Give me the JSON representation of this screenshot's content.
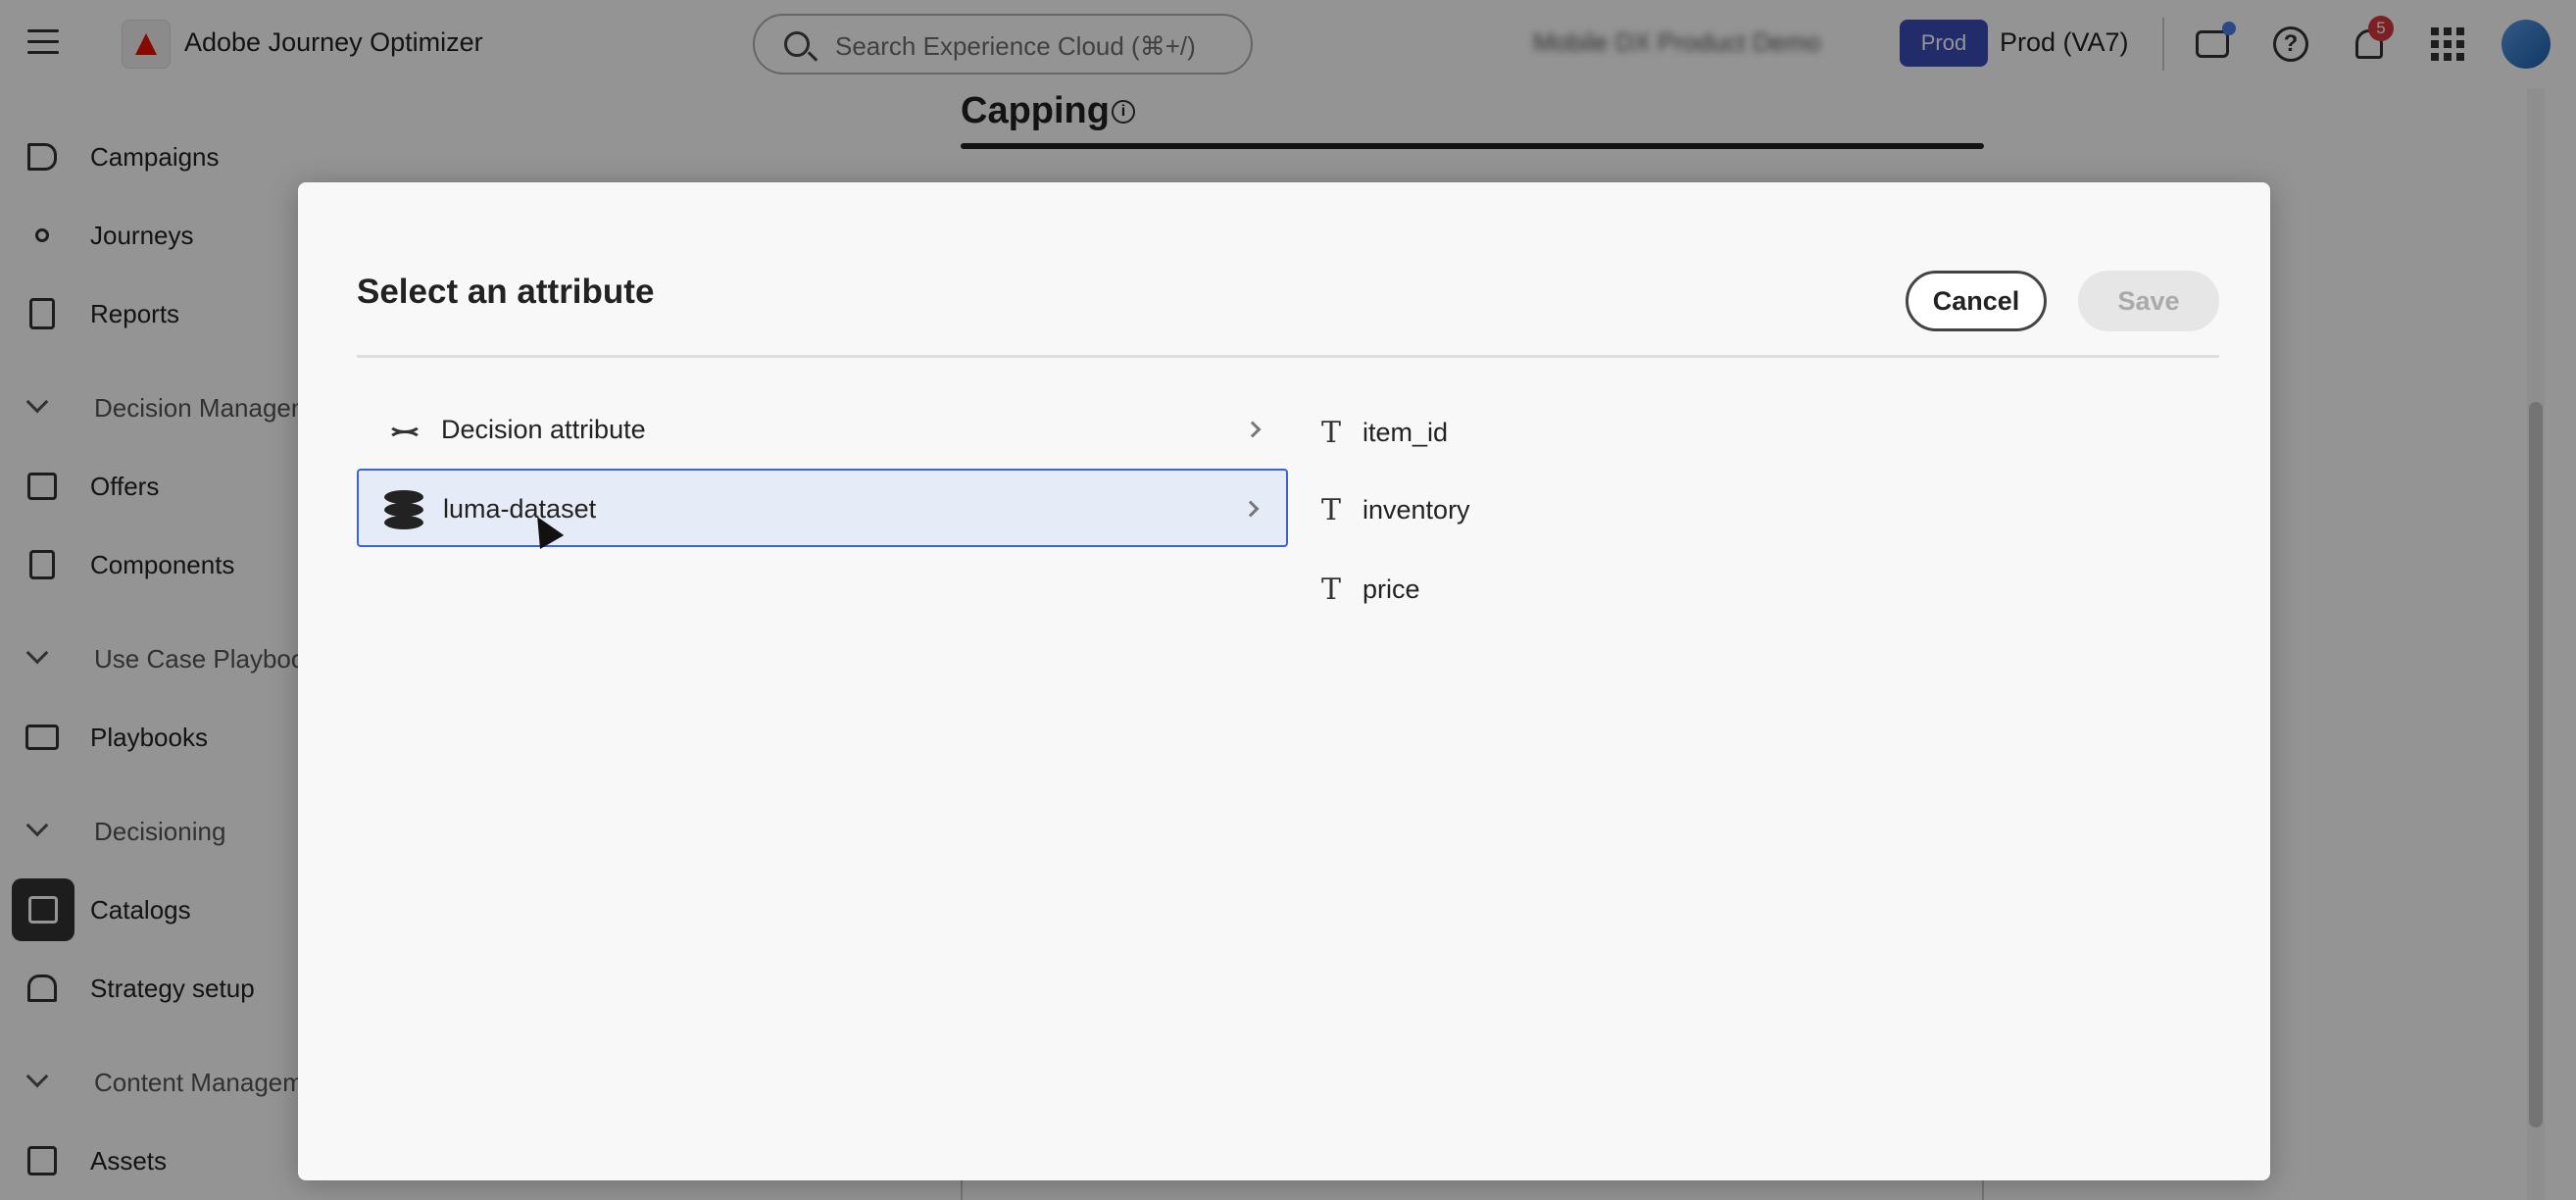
{
  "app": {
    "title": "Adobe Journey Optimizer"
  },
  "search": {
    "placeholder": "Search Experience Cloud (⌘+/)"
  },
  "header": {
    "org_name": "Mobile DX Product Demo",
    "sandbox_badge": "Prod",
    "sandbox_label": "Prod (VA7)",
    "notification_count": "5"
  },
  "sidebar": {
    "items": [
      {
        "label": "Campaigns",
        "icon": "megaphone-icon"
      },
      {
        "label": "Journeys",
        "icon": "journey-icon"
      },
      {
        "label": "Reports",
        "icon": "report-icon"
      },
      {
        "label": "Decision Management",
        "section": true
      },
      {
        "label": "Offers",
        "icon": "offer-icon"
      },
      {
        "label": "Components",
        "icon": "components-icon"
      },
      {
        "label": "Use Case Playbooks",
        "section": true
      },
      {
        "label": "Playbooks",
        "icon": "playbook-icon"
      },
      {
        "label": "Decisioning",
        "section": true
      },
      {
        "label": "Catalogs",
        "icon": "catalog-icon",
        "active": true
      },
      {
        "label": "Strategy setup",
        "icon": "strategy-icon"
      },
      {
        "label": "Content Management",
        "section": true
      },
      {
        "label": "Assets",
        "icon": "assets-icon"
      }
    ]
  },
  "page": {
    "title": "Capping"
  },
  "dialog": {
    "title": "Select an attribute",
    "cancel_label": "Cancel",
    "save_label": "Save",
    "sources": [
      {
        "label": "Decision attribute",
        "icon": "dna-icon"
      },
      {
        "label": "luma-dataset",
        "icon": "database-icon",
        "selected": true
      }
    ],
    "fields": [
      {
        "label": "item_id",
        "icon": "text-type-icon"
      },
      {
        "label": "inventory",
        "icon": "text-type-icon"
      },
      {
        "label": "price",
        "icon": "text-type-icon"
      }
    ]
  },
  "colors": {
    "accent": "#3b63d1",
    "sandbox_badge": "#3d4db8",
    "notification_badge": "#d7373f",
    "brand": "#eb1000"
  }
}
